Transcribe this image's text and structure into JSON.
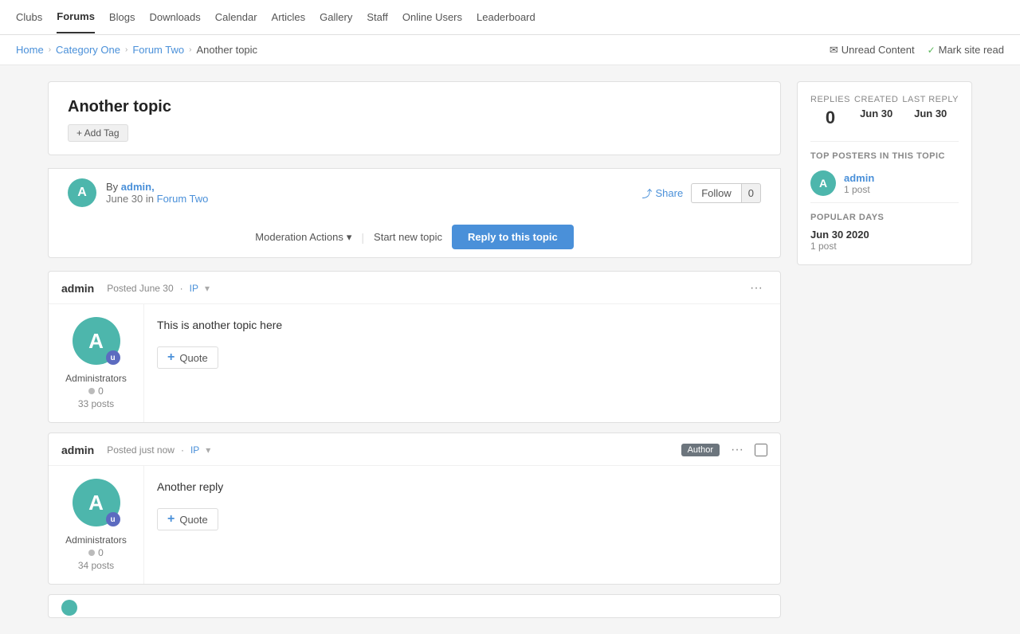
{
  "nav": {
    "items": [
      {
        "label": "Clubs",
        "active": false
      },
      {
        "label": "Forums",
        "active": true
      },
      {
        "label": "Blogs",
        "active": false
      },
      {
        "label": "Downloads",
        "active": false
      },
      {
        "label": "Calendar",
        "active": false
      },
      {
        "label": "Articles",
        "active": false
      },
      {
        "label": "Gallery",
        "active": false
      },
      {
        "label": "Staff",
        "active": false
      },
      {
        "label": "Online Users",
        "active": false
      },
      {
        "label": "Leaderboard",
        "active": false
      }
    ]
  },
  "breadcrumb": {
    "items": [
      {
        "label": "Home",
        "link": true
      },
      {
        "label": "Category One",
        "link": true
      },
      {
        "label": "Forum Two",
        "link": true
      },
      {
        "label": "Another topic",
        "link": false
      }
    ],
    "unread_label": "Unread Content",
    "mark_read_label": "Mark site read"
  },
  "topic": {
    "title": "Another topic",
    "add_tag_label": "+ Add Tag",
    "author": "admin,",
    "date": "June 30",
    "forum": "Forum Two",
    "share_label": "Share",
    "follow_label": "Follow",
    "follow_count": "0",
    "moderation_label": "Moderation Actions",
    "start_topic_label": "Start new topic",
    "reply_label": "Reply to this topic"
  },
  "stats": {
    "replies_label": "Replies",
    "replies_value": "0",
    "created_label": "Created",
    "created_value": "Jun 30",
    "last_reply_label": "Last Reply",
    "last_reply_value": "Jun 30"
  },
  "top_posters": {
    "section_title": "TOP POSTERS IN THIS TOPIC",
    "items": [
      {
        "name": "admin",
        "posts": "1 post",
        "avatar_letter": "A"
      }
    ]
  },
  "popular_days": {
    "section_title": "POPULAR DAYS",
    "items": [
      {
        "date": "Jun 30 2020",
        "posts": "1 post"
      }
    ]
  },
  "posts": [
    {
      "author": "admin",
      "posted_label": "Posted June 30",
      "ip_label": "IP",
      "avatar_letter": "A",
      "group": "Administrators",
      "rep": "0",
      "posts": "33 posts",
      "content": "This is another topic here",
      "quote_label": "Quote",
      "is_author": false
    },
    {
      "author": "admin",
      "posted_label": "Posted just now",
      "ip_label": "IP",
      "avatar_letter": "A",
      "group": "Administrators",
      "rep": "0",
      "posts": "34 posts",
      "content": "Another reply",
      "quote_label": "Quote",
      "is_author": true,
      "author_badge": "Author"
    }
  ]
}
